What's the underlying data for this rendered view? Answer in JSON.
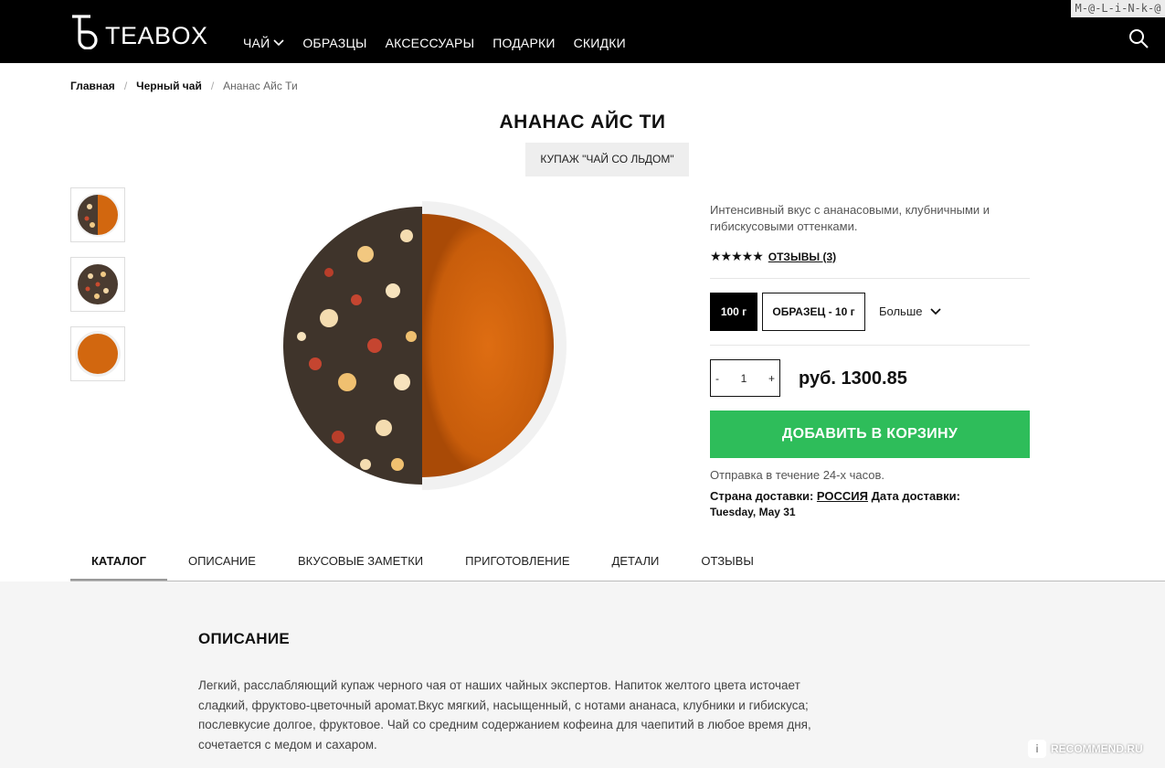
{
  "header": {
    "logo_text": "TEABOX",
    "nav": [
      {
        "label": "ЧАЙ",
        "has_dropdown": true
      },
      {
        "label": "ОБРАЗЦЫ"
      },
      {
        "label": "АКСЕССУАРЫ"
      },
      {
        "label": "ПОДАРКИ"
      },
      {
        "label": "СКИДКИ"
      }
    ],
    "search_icon": "search-icon"
  },
  "watermark_top": "M-@-L-i-N-k-@",
  "breadcrumb": {
    "items": [
      "Главная",
      "Черный чай"
    ],
    "current": "Ананас Айс Ти",
    "separator": "/"
  },
  "product": {
    "title": "АНАНАС АЙС ТИ",
    "tag": "КУПАЖ \"ЧАЙ СО ЛЬДОМ\"",
    "short_description": "Интенсивный вкус с ананасовыми, клубничными и гибискусовыми оттенками.",
    "stars": "★★★★★",
    "rating": 5,
    "reviews_label": "ОТЗЫВЫ (3)",
    "sizes": {
      "active": "100 г",
      "sample": "ОБРАЗЕЦ - 10 г",
      "more": "Больше"
    },
    "quantity": {
      "minus": "-",
      "value": "1",
      "plus": "+"
    },
    "price": "руб. 1300.85",
    "add_to_cart": "ДОБАВИТЬ В КОРЗИНУ",
    "shipping": "Отправка в течение 24-х часов.",
    "delivery": {
      "country_label": "Страна доставки:",
      "country": "РОССИЯ",
      "date_label": "Дата доставки:",
      "date": "Tuesday, May 31"
    }
  },
  "tabs": [
    "КАТАЛОГ",
    "ОПИСАНИЕ",
    "ВКУСОВЫЕ ЗАМЕТКИ",
    "ПРИГОТОВЛЕНИЕ",
    "ДЕТАЛИ",
    "ОТЗЫВЫ"
  ],
  "active_tab": "КАТАЛОГ",
  "description": {
    "title": "ОПИСАНИЕ",
    "body": "Легкий, расслабляющий купаж черного чая от наших чайных экспертов. Напиток желтого цвета источает сладкий, фруктово-цветочный аромат.Вкус мягкий, насыщенный, с нотами ананаса, клубники и гибискуса; послевкусие долгое, фруктовое. Чай со средним содержанием кофеина для чаепитий в любое время дня, сочетается с медом и сахаром."
  },
  "watermark_bottom": "RECOMMEND.RU",
  "colors": {
    "header_bg": "#000000",
    "cart_button": "#2ebd5a",
    "tea_liquid": "#d86a10",
    "section_bg": "#f5f5f5"
  }
}
